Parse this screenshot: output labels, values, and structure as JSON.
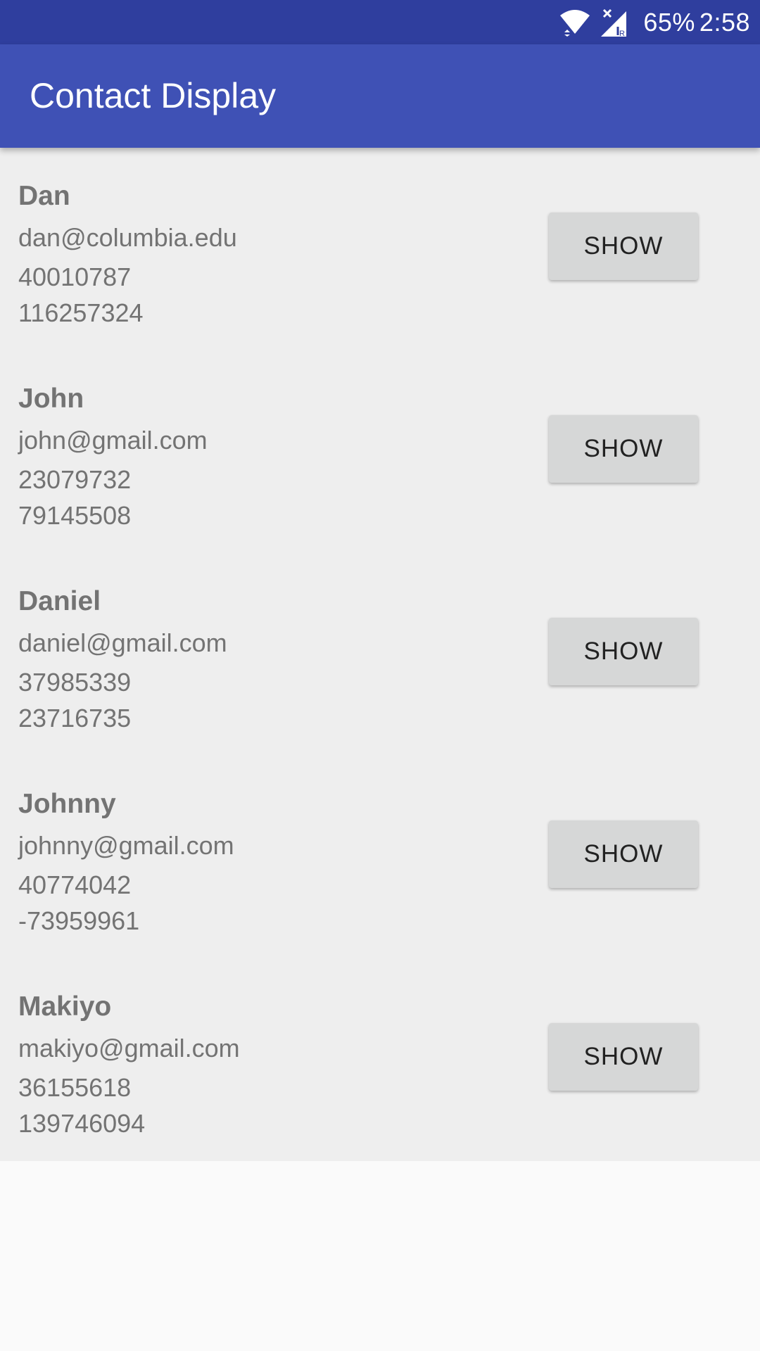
{
  "status_bar": {
    "battery": "65%",
    "time": "2:58",
    "icons": [
      "wifi-icon",
      "signal-icon"
    ]
  },
  "app_bar": {
    "title": "Contact Display"
  },
  "colors": {
    "status_bar": "#2f3e9e",
    "app_bar": "#3f51b5",
    "list_background": "#eeeeee",
    "button": "#d6d7d7"
  },
  "contacts": [
    {
      "name": "Dan",
      "email": "dan@columbia.edu",
      "lat": "40010787",
      "lng": "116257324",
      "button": "SHOW"
    },
    {
      "name": "John",
      "email": "john@gmail.com",
      "lat": "23079732",
      "lng": "79145508",
      "button": "SHOW"
    },
    {
      "name": "Daniel",
      "email": "daniel@gmail.com",
      "lat": "37985339",
      "lng": "23716735",
      "button": "SHOW"
    },
    {
      "name": "Johnny",
      "email": "johnny@gmail.com",
      "lat": "40774042",
      "lng": "-73959961",
      "button": "SHOW"
    },
    {
      "name": "Makiyo",
      "email": "makiyo@gmail.com",
      "lat": "36155618",
      "lng": "139746094",
      "button": "SHOW"
    }
  ]
}
